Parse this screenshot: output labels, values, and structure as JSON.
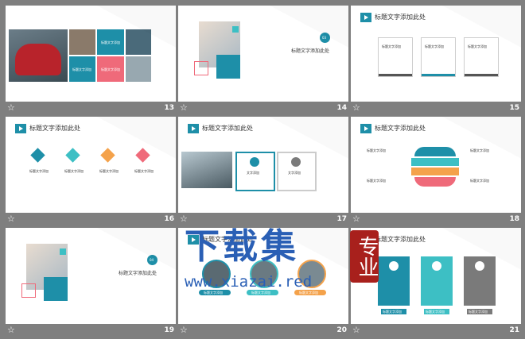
{
  "slides": [
    {
      "num": "13",
      "boxes": [
        "标题文字添加",
        "标题文字添加",
        "标题文字添加"
      ]
    },
    {
      "num": "14",
      "badge": "03",
      "heading": "标题文字添加此处"
    },
    {
      "num": "15",
      "title": "标题文字添加此处",
      "cards": [
        "标题文字添加",
        "标题文字添加",
        "标题文字添加"
      ]
    },
    {
      "num": "16",
      "title": "标题文字添加此处",
      "items": [
        "标题文字添加",
        "标题文字添加",
        "标题文字添加",
        "标题文字添加"
      ]
    },
    {
      "num": "17",
      "title": "标题文字添加此处",
      "boxes": [
        "文字添加",
        "文字添加"
      ]
    },
    {
      "num": "18",
      "title": "标题文字添加此处",
      "items": [
        "标题文字添加",
        "标题文字添加",
        "标题文字添加",
        "标题文字添加"
      ]
    },
    {
      "num": "19",
      "badge": "04",
      "heading": "标题文字添加此处"
    },
    {
      "num": "20",
      "title": "标题文字添加此处",
      "pills": [
        "标题文字添加",
        "标题文字添加",
        "标题文字添加"
      ]
    },
    {
      "num": "21",
      "title": "标题文字添加此处",
      "buttons": [
        "标题文字添加",
        "标题文字添加",
        "标题文字添加"
      ]
    }
  ],
  "watermark": {
    "big": "下载集",
    "seal": "专业",
    "url": "www.xiazai.red"
  },
  "colors": {
    "teal": "#1e8fa8",
    "teal2": "#3dbfc4",
    "orange": "#f4a24b",
    "pink": "#ef6a7a",
    "gray": "#7a7a7a"
  },
  "icons": {
    "star": "☆"
  }
}
